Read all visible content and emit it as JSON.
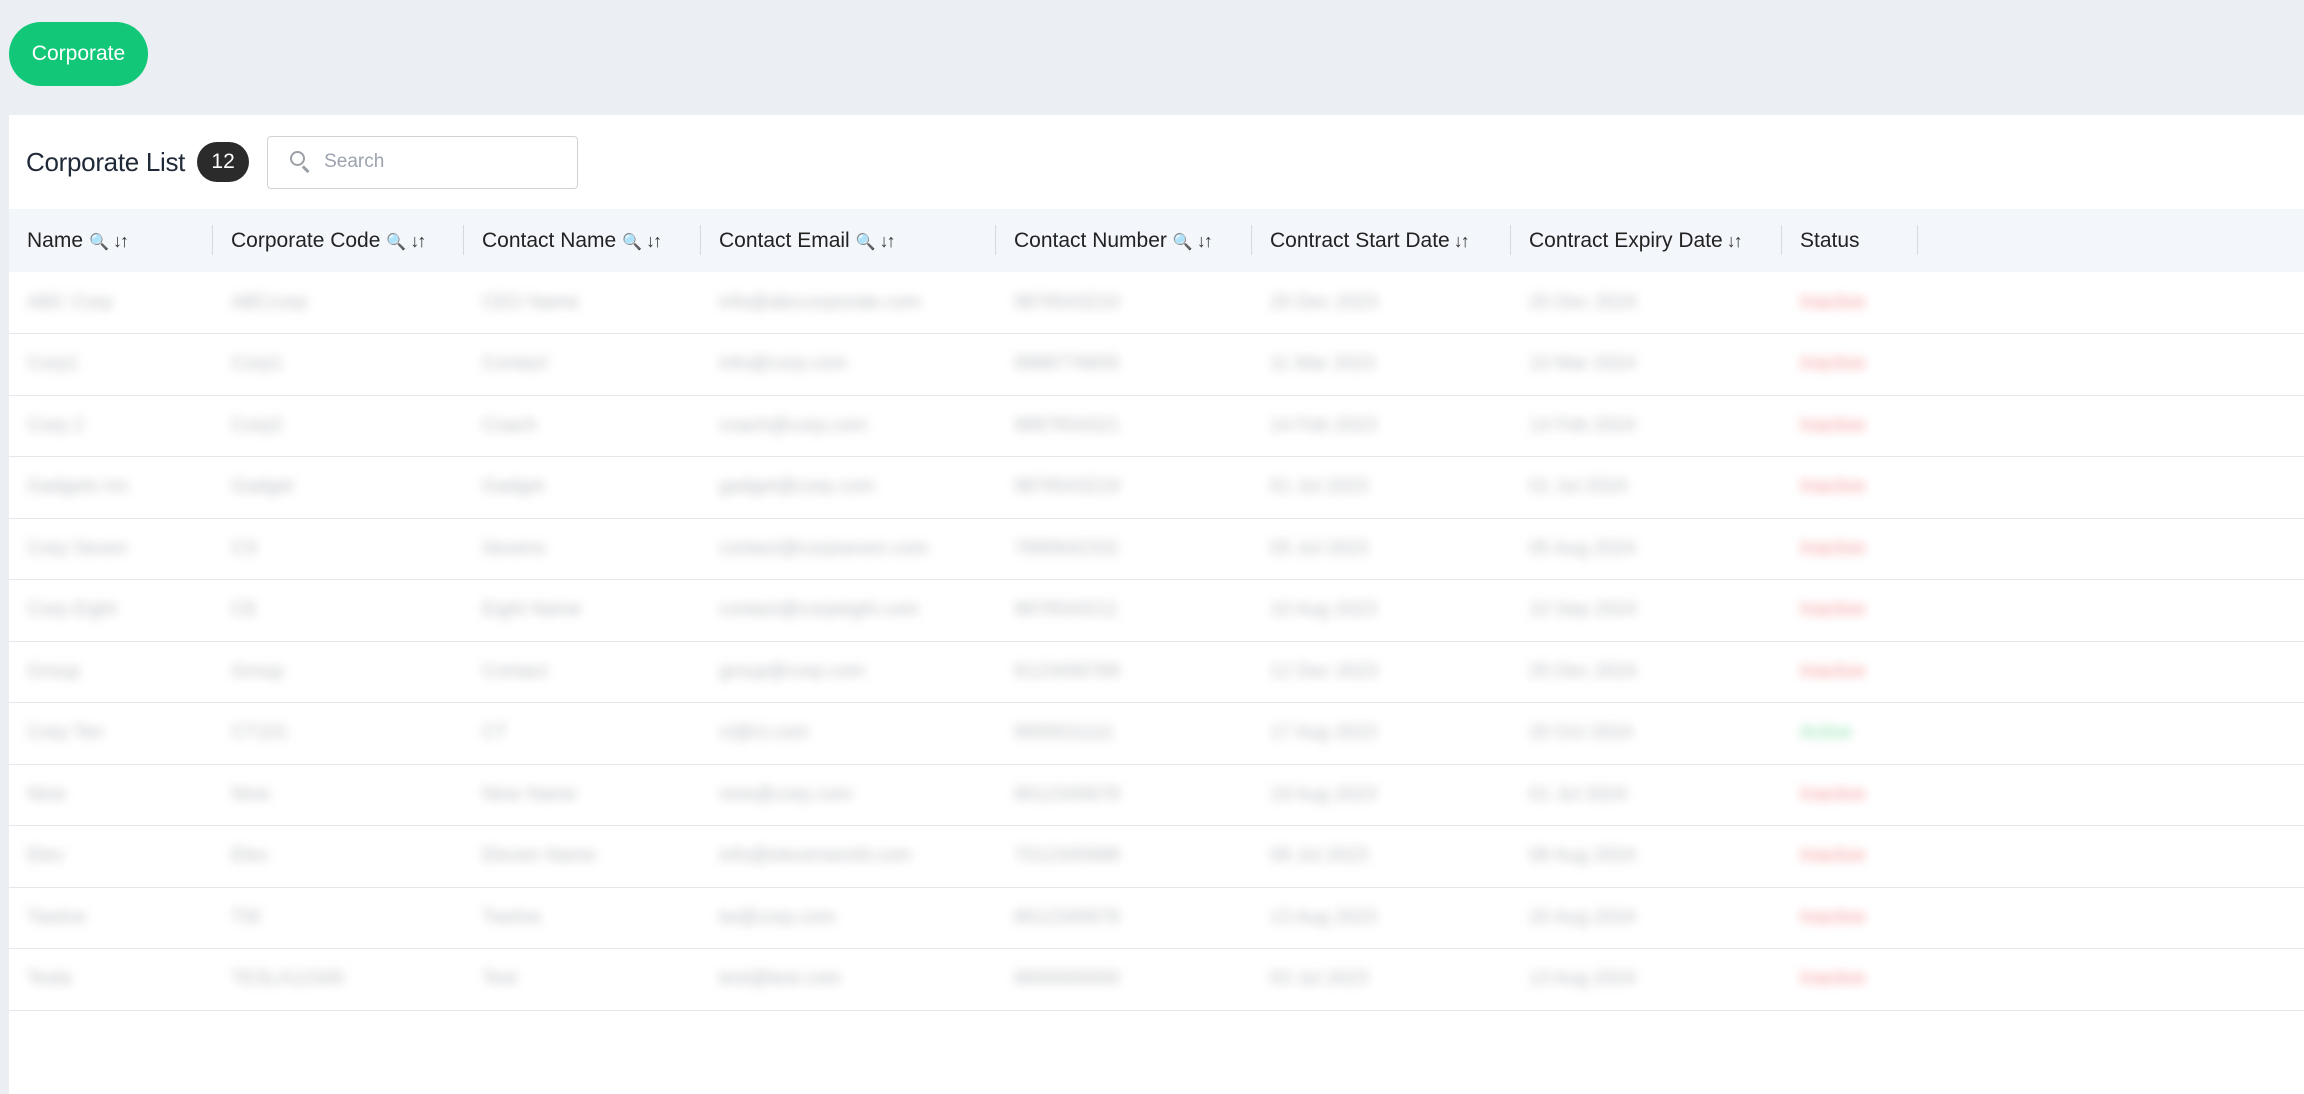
{
  "header": {
    "button_label": "Corporate"
  },
  "list": {
    "title": "Corporate List",
    "count": "12"
  },
  "search": {
    "placeholder": "Search"
  },
  "columns": [
    {
      "label": "Name",
      "searchable": true,
      "sortable": true
    },
    {
      "label": "Corporate Code",
      "searchable": true,
      "sortable": true
    },
    {
      "label": "Contact Name",
      "searchable": true,
      "sortable": true
    },
    {
      "label": "Contact Email",
      "searchable": true,
      "sortable": true
    },
    {
      "label": "Contact Number",
      "searchable": true,
      "sortable": true
    },
    {
      "label": "Contract Start Date",
      "searchable": false,
      "sortable": true
    },
    {
      "label": "Contract Expiry Date",
      "searchable": false,
      "sortable": true
    },
    {
      "label": "Status",
      "searchable": false,
      "sortable": false
    }
  ],
  "icons": {
    "search_column": "magnifier-icon",
    "sort": "sort-arrows-icon"
  },
  "colors": {
    "accent": "#12c878",
    "inactive": "#ef4444",
    "active": "#22c55e"
  },
  "rows": [
    [
      "ABC Corp",
      "ABCcorp",
      "CEO Name",
      "info@abccorporate.com",
      "9876543210",
      "20 Dec 2023",
      "20 Dec 2024",
      "Inactive"
    ],
    [
      "Corp1",
      "Corp1",
      "Contact",
      "info@corp.com",
      "9988776655",
      "11 Mar 2023",
      "10 Mar 2024",
      "Inactive"
    ],
    [
      "Corp 2",
      "Corp2",
      "Coach",
      "coach@corp.com",
      "9887654321",
      "14 Feb 2023",
      "14 Feb 2024",
      "Inactive"
    ],
    [
      "Gadgets Inc",
      "Gadget",
      "Gadget",
      "gadget@corp.com",
      "9876543219",
      "01 Jul 2023",
      "01 Jul 2024",
      "Inactive"
    ],
    [
      "Corp Seven",
      "CS",
      "Sevens",
      "contact@corpseven.com",
      "7895642331",
      "05 Jul 2023",
      "05 Aug 2024",
      "Inactive"
    ],
    [
      "Corp Eight",
      "CE",
      "Eight Name",
      "contact@corpeight.com",
      "9876543211",
      "10 Aug 2023",
      "10 Sep 2024",
      "Inactive"
    ],
    [
      "Group",
      "Group",
      "Contact",
      "group@corp.com",
      "9123456789",
      "12 Dec 2023",
      "25 Dec 2024",
      "Inactive"
    ],
    [
      "Corp Ten",
      "CT101",
      "CT",
      "ct@ct.com",
      "9000011111",
      "17 Aug 2023",
      "20 Oct 2024",
      "Active"
    ],
    [
      "Nine",
      "Nine",
      "Nine Name",
      "nine@corp.com",
      "9012345678",
      "19 Aug 2023",
      "01 Jul 2024",
      "Inactive"
    ],
    [
      "Elev",
      "Elev",
      "Eleven Name",
      "info@elevenworld.com",
      "7012345688",
      "08 Jul 2023",
      "08 Aug 2024",
      "Inactive"
    ],
    [
      "Twelve",
      "TW",
      "Twelve",
      "tw@corp.com",
      "8012345678",
      "13 Aug 2023",
      "20 Aug 2024",
      "Inactive"
    ],
    [
      "Tesla",
      "TESLA12345",
      "Test",
      "test@test.com",
      "9000000000",
      "03 Jul 2023",
      "13 Aug 2024",
      "Inactive"
    ]
  ]
}
